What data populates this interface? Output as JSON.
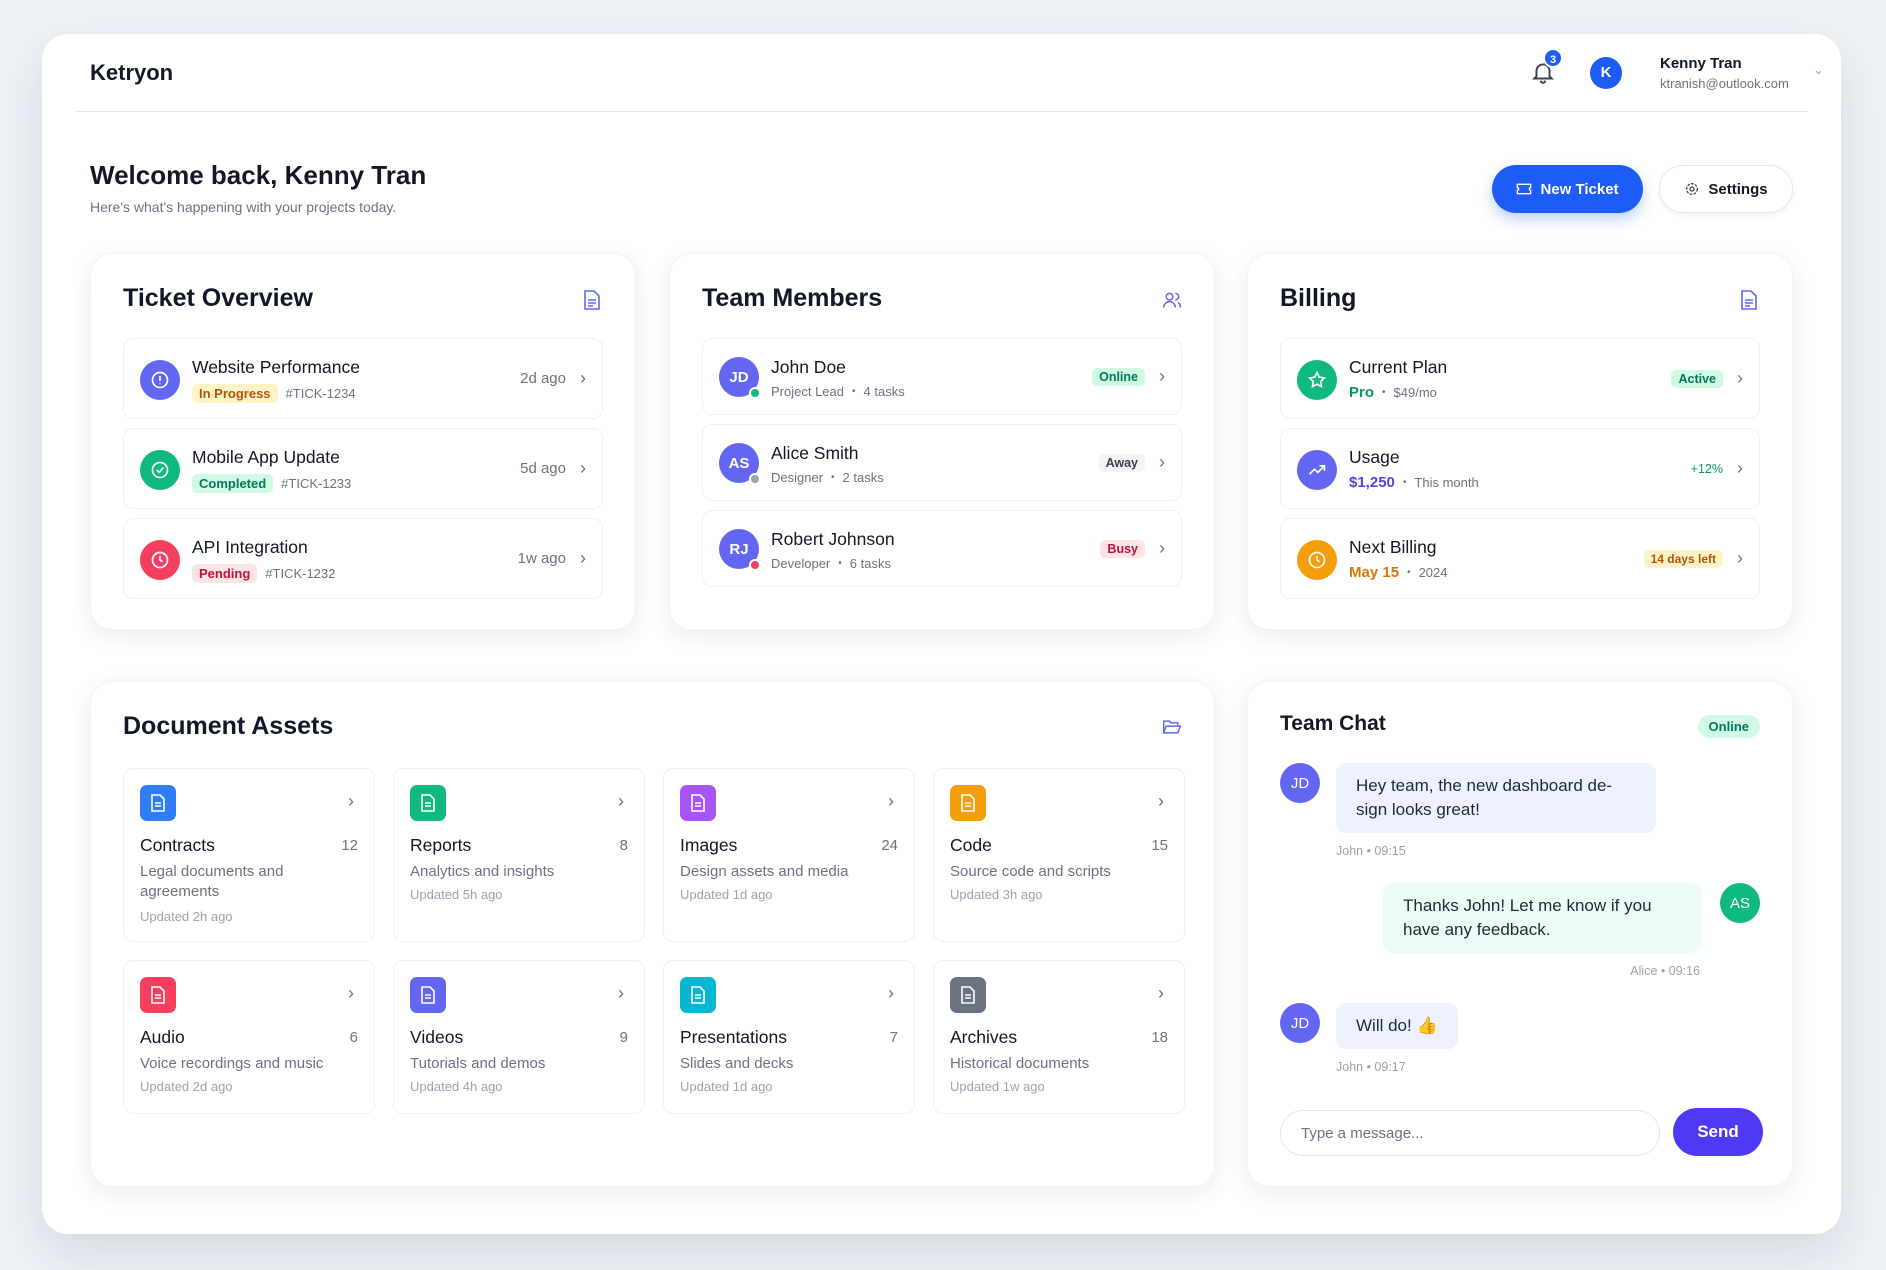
{
  "header": {
    "brand": "Ketryon",
    "notif_count": "3",
    "user": {
      "initial": "K",
      "name": "Kenny Tran",
      "email": "ktranish@outlook.com"
    }
  },
  "welcome": {
    "title": "Welcome back, Kenny Tran",
    "subtitle": "Here's what's happening with your projects today.",
    "new_ticket": "New Ticket",
    "settings": "Settings"
  },
  "tickets": {
    "title": "Ticket Overview",
    "items": [
      {
        "title": "Website Performance",
        "status": "In Progress",
        "id": "#TICK-1234",
        "time": "2d ago",
        "color": "#6366f1"
      },
      {
        "title": "Mobile App Update",
        "status": "Completed",
        "id": "#TICK-1233",
        "time": "5d ago",
        "color": "#10b981"
      },
      {
        "title": "API Integration",
        "status": "Pending",
        "id": "#TICK-1232",
        "time": "1w ago",
        "color": "#f43f5e"
      }
    ]
  },
  "team": {
    "title": "Team Members",
    "members": [
      {
        "initials": "JD",
        "name": "John Doe",
        "role": "Project Lead",
        "tasks": "4 tasks",
        "status": "Online"
      },
      {
        "initials": "AS",
        "name": "Alice Smith",
        "role": "Designer",
        "tasks": "2 tasks",
        "status": "Away"
      },
      {
        "initials": "RJ",
        "name": "Robert Johnson",
        "role": "Developer",
        "tasks": "6 tasks",
        "status": "Busy"
      }
    ]
  },
  "billing": {
    "title": "Billing",
    "items": [
      {
        "title": "Current Plan",
        "value": "Pro",
        "detail": "$49/mo",
        "badge": "Active"
      },
      {
        "title": "Usage",
        "value": "$1,250",
        "detail": "This month",
        "badge": "+12%"
      },
      {
        "title": "Next Billing",
        "value": "May 15",
        "detail": "2024",
        "badge": "14 days left"
      }
    ]
  },
  "assets": {
    "title": "Document Assets",
    "tiles": [
      {
        "name": "Contracts",
        "count": "12",
        "desc": "Legal documents and agreements",
        "updated": "Updated 2h ago",
        "color": "#2f7cf6"
      },
      {
        "name": "Reports",
        "count": "8",
        "desc": "Analytics and insights",
        "updated": "Updated 5h ago",
        "color": "#10b981"
      },
      {
        "name": "Images",
        "count": "24",
        "desc": "Design assets and media",
        "updated": "Updated 1d ago",
        "color": "#a855f7"
      },
      {
        "name": "Code",
        "count": "15",
        "desc": "Source code and scripts",
        "updated": "Updated 3h ago",
        "color": "#f59e0b"
      },
      {
        "name": "Audio",
        "count": "6",
        "desc": "Voice recordings and music",
        "updated": "Updated 2d ago",
        "color": "#f43f5e"
      },
      {
        "name": "Videos",
        "count": "9",
        "desc": "Tutorials and demos",
        "updated": "Updated 4h ago",
        "color": "#6366f1"
      },
      {
        "name": "Presentations",
        "count": "7",
        "desc": "Slides and decks",
        "updated": "Updated 1d ago",
        "color": "#06b6d4"
      },
      {
        "name": "Archives",
        "count": "18",
        "desc": "Historical documents",
        "updated": "Updated 1w ago",
        "color": "#6b7280"
      }
    ]
  },
  "chat": {
    "title": "Team Chat",
    "status": "Online",
    "messages": [
      {
        "initials": "JD",
        "text": "Hey team, the new dashboard de-sign looks great!",
        "meta": "John • 09:15"
      },
      {
        "initials": "AS",
        "text": "Thanks John! Let me know if you have any feedback.",
        "meta": "Alice • 09:16"
      },
      {
        "initials": "JD",
        "text": "Will do! 👍",
        "meta": "John • 09:17"
      }
    ],
    "placeholder": "Type a message...",
    "send": "Send"
  }
}
